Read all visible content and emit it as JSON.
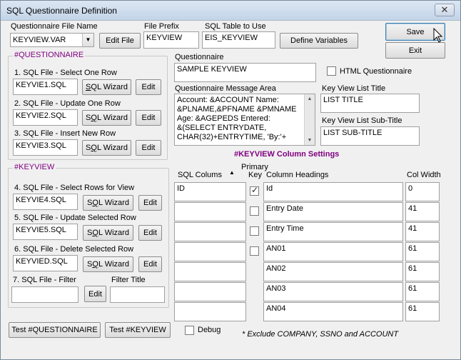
{
  "window": {
    "title": "SQL Questionnaire Definition",
    "close_glyph": "✕"
  },
  "top": {
    "qfile_label": "Questionnaire File Name",
    "qfile_value": "KEYVIEW.VAR",
    "edit_file": "Edit File",
    "prefix_label": "File Prefix",
    "prefix_value": "KEYVIEW",
    "sqltable_label": "SQL Table to Use",
    "sqltable_value": "EIS_KEYVIEW",
    "define_vars": "Define Variables",
    "save": "Save",
    "exit": "Exit"
  },
  "questionnaire_group": {
    "title": "#QUESTIONNAIRE",
    "rows": [
      {
        "label": "1. SQL File - Select One Row",
        "value": "KEYVIE1.SQL",
        "wizard": "SQL Wizard",
        "edit": "Edit"
      },
      {
        "label": "2. SQL File - Update One Row",
        "value": "KEYVIE2.SQL",
        "wizard": "SQL Wizard",
        "edit": "Edit"
      },
      {
        "label": "3. SQL File -  Insert New Row",
        "value": "KEYVIE3.SQL",
        "wizard": "SQL Wizard",
        "edit": "Edit"
      }
    ]
  },
  "keyview_group": {
    "title": "#KEYVIEW",
    "rows": [
      {
        "label": "4. SQL File -  Select Rows for View",
        "value": "KEYVIE4.SQL",
        "wizard": "SQL Wizard",
        "edit": "Edit"
      },
      {
        "label": "5. SQL File -  Update Selected Row",
        "value": "KEYVIE5.SQL",
        "wizard": "SQL Wizard",
        "edit": "Edit"
      },
      {
        "label": "6. SQL File -  Delete Selected Row",
        "value": "KEYVIED.SQL",
        "wizard": "SQL Wizard",
        "edit": "Edit"
      }
    ],
    "filter_label": "7. SQL File -  Filter",
    "filter_value": "",
    "filter_edit": "Edit",
    "filter_title_label": "Filter Title",
    "filter_title_value": ""
  },
  "questionnaire": {
    "label": "Questionnaire",
    "value": "SAMPLE KEYVIEW",
    "html_label": "HTML Questionnaire",
    "html_checked": false
  },
  "message_area": {
    "label": "Questionnaire Message Area",
    "lines": [
      "Account: &ACCOUNT Name:",
      "&PLNAME,&PFNAME &PMNAME",
      "Age: &AGEPEDS Entered:",
      "&(SELECT ENTRYDATE,",
      "CHAR(32)+ENTRYTIME, 'By:'+"
    ]
  },
  "list_title": {
    "label": "Key View List Title",
    "value": "LIST TITLE"
  },
  "list_subtitle": {
    "label": "Key View List Sub-Title",
    "value": "LIST SUB-TITLE"
  },
  "column_settings": {
    "title": "#KEYVIEW Column Settings",
    "col_sql": "SQL Colums",
    "col_primary_top": "Primary",
    "col_primary_bottom": "Key",
    "col_headings": "Column Headings",
    "col_width": "Col Width",
    "rows": [
      {
        "sql": "ID",
        "key": true,
        "heading": "Id",
        "width": "0"
      },
      {
        "sql": "",
        "key": false,
        "heading": "Entry Date",
        "width": "41"
      },
      {
        "sql": "",
        "key": false,
        "heading": "Entry Time",
        "width": "41"
      },
      {
        "sql": "",
        "key": false,
        "heading": "AN01",
        "width": "61"
      },
      {
        "sql": "",
        "key": null,
        "heading": "AN02",
        "width": "61"
      },
      {
        "sql": "",
        "key": null,
        "heading": "AN03",
        "width": "61"
      },
      {
        "sql": "",
        "key": null,
        "heading": "AN04",
        "width": "61"
      }
    ]
  },
  "bottom": {
    "test_q": "Test #QUESTIONNAIRE",
    "test_k": "Test #KEYVIEW",
    "debug": "Debug",
    "debug_checked": false,
    "note": "* Exclude COMPANY, SSNO and ACCOUNT"
  }
}
